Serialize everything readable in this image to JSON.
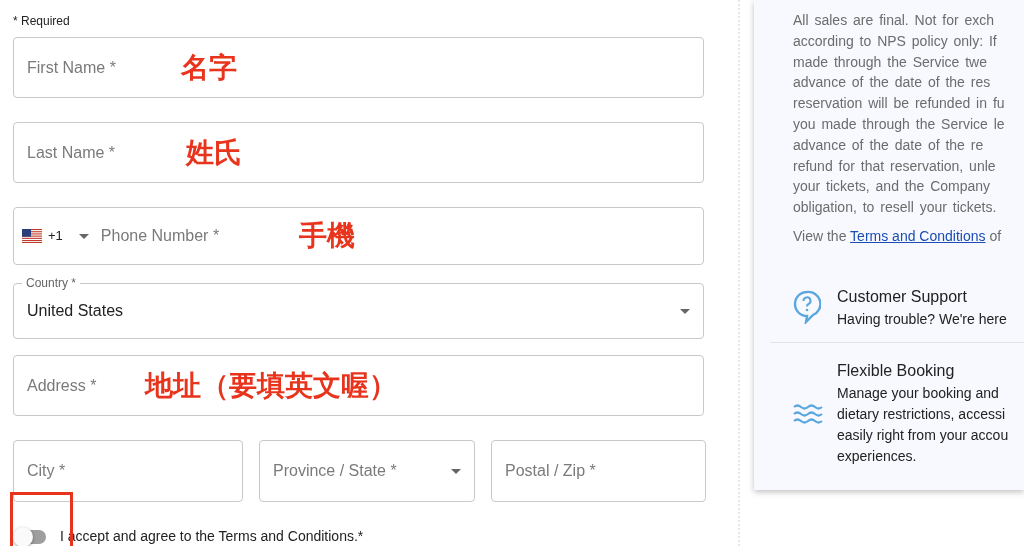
{
  "required_note": "* Required",
  "fields": [
    {
      "kind": "text",
      "placeholder": "First Name *",
      "annotation": "名字"
    },
    {
      "kind": "text",
      "placeholder": "Last Name *",
      "annotation": "姓氏"
    },
    {
      "kind": "phone",
      "country_code": "+1",
      "placeholder": "Phone Number *",
      "annotation": "手機"
    },
    {
      "kind": "select",
      "label": "Country *",
      "value": "United States"
    },
    {
      "kind": "text",
      "placeholder": "Address *",
      "annotation": "地址（要填英文喔）"
    }
  ],
  "address_row": [
    {
      "kind": "text",
      "placeholder": "City *"
    },
    {
      "kind": "select",
      "placeholder": "Province / State *"
    },
    {
      "kind": "text",
      "placeholder": "Postal / Zip *"
    }
  ],
  "terms": {
    "checked": false,
    "label": "I accept and agree to the Terms and Conditions.*",
    "highlighted": true
  },
  "sidebar": {
    "policy_lines": [
      "All sales are final. Not for exch",
      "according to NPS policy only: If",
      "made through the Service twe",
      "advance of the date of the res",
      "reservation will be refunded in fu",
      "you made through the Service le",
      "advance of the date of the re",
      "refund for that reservation, unle",
      "your tickets, and the Company",
      "obligation, to resell your tickets."
    ],
    "terms_line": {
      "before": "View the",
      "link": "Terms and Conditions",
      "after": "of"
    },
    "features": [
      {
        "kind": "support",
        "title": "Customer Support",
        "lines": [
          "Having trouble? We're here"
        ]
      },
      {
        "kind": "booking",
        "title": "Flexible Booking",
        "lines": [
          "Manage your booking and",
          "dietary restrictions, accessi",
          "easily right from your accou",
          "experiences."
        ]
      }
    ]
  }
}
